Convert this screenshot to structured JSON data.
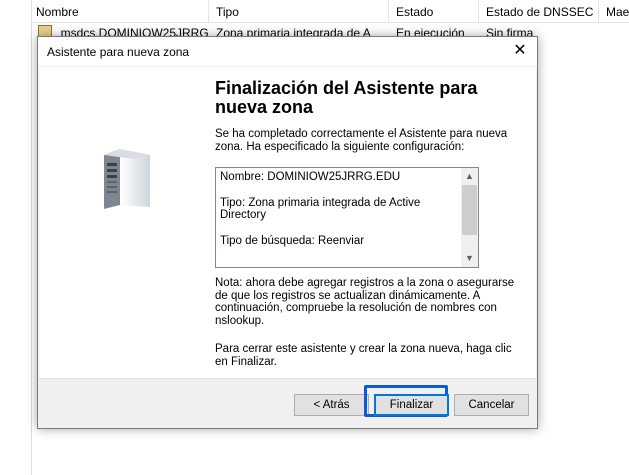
{
  "background": {
    "columns": [
      "Nombre",
      "Tipo",
      "Estado",
      "Estado de DNSSEC",
      "Mae"
    ],
    "row": {
      "name": "_msdcs.DOMINIOW25JRRG",
      "type": "Zona primaria integrada de A",
      "status": "En ejecución",
      "dnssec": "Sin firma"
    }
  },
  "dialog": {
    "title": "Asistente para nueva zona",
    "close_symbol": "✕",
    "heading": "Finalización del Asistente para nueva zona",
    "intro": "Se ha completado correctamente el Asistente para nueva zona. Ha especificado la siguiente configuración:",
    "summary": {
      "name_line": "Nombre:  DOMINIOW25JRRG.EDU",
      "type_line": "Tipo:       Zona primaria integrada de Active Directory",
      "lookup_line": "Tipo de búsqueda:  Reenviar"
    },
    "note": "Nota: ahora debe agregar registros a la zona o asegurarse de que los registros se actualizan dinámicamente. A continuación, compruebe la resolución de nombres con nslookup.",
    "finish_text": "Para cerrar este asistente y crear la zona nueva, haga clic en Finalizar.",
    "buttons": {
      "back": "< Atrás",
      "finish": "Finalizar",
      "cancel": "Cancelar"
    }
  },
  "icons": {
    "server": "server-icon",
    "zone": "zone-icon",
    "scroll_up": "▲",
    "scroll_down": "▼"
  },
  "colors": {
    "focus_highlight": "#0b5bd8",
    "default_button_border": "#0078d7"
  }
}
